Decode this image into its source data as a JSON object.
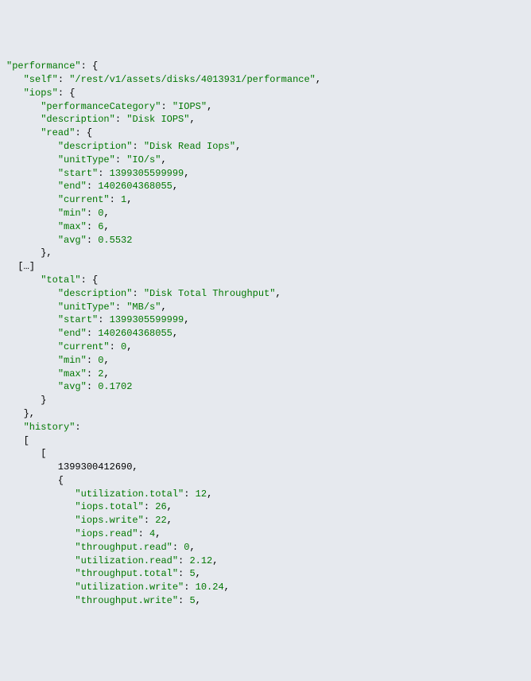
{
  "lines": [
    {
      "indent": 0,
      "key": "\"performance\"",
      "colon": ": {"
    },
    {
      "indent": 3,
      "key": "\"self\"",
      "colon": ": ",
      "value": "\"/rest/v1/assets/disks/4013931/performance\"",
      "suffix": ","
    },
    {
      "indent": 3,
      "key": "\"iops\"",
      "colon": ": {"
    },
    {
      "indent": 6,
      "key": "\"performanceCategory\"",
      "colon": ": ",
      "value": "\"IOPS\"",
      "suffix": ","
    },
    {
      "indent": 6,
      "key": "\"description\"",
      "colon": ": ",
      "value": "\"Disk IOPS\"",
      "suffix": ","
    },
    {
      "indent": 6,
      "key": "\"read\"",
      "colon": ": {"
    },
    {
      "indent": 9,
      "key": "\"description\"",
      "colon": ": ",
      "value": "\"Disk Read Iops\"",
      "suffix": ","
    },
    {
      "indent": 9,
      "key": "\"unitType\"",
      "colon": ": ",
      "value": "\"IO/s\"",
      "suffix": ","
    },
    {
      "indent": 9,
      "key": "\"start\"",
      "colon": ": ",
      "value": "1399305599999",
      "suffix": ","
    },
    {
      "indent": 9,
      "key": "\"end\"",
      "colon": ": ",
      "value": "1402604368055",
      "suffix": ","
    },
    {
      "indent": 9,
      "key": "\"current\"",
      "colon": ": ",
      "value": "1",
      "suffix": ","
    },
    {
      "indent": 9,
      "key": "\"min\"",
      "colon": ": ",
      "value": "0",
      "suffix": ","
    },
    {
      "indent": 9,
      "key": "\"max\"",
      "colon": ": ",
      "value": "6",
      "suffix": ","
    },
    {
      "indent": 9,
      "key": "\"avg\"",
      "colon": ": ",
      "value": "0.5532"
    },
    {
      "indent": 6,
      "plain": "},"
    },
    {
      "indent": 2,
      "plain": "[…]"
    },
    {
      "indent": 6,
      "key": "\"total\"",
      "colon": ": {"
    },
    {
      "indent": 9,
      "key": "\"description\"",
      "colon": ": ",
      "value": "\"Disk Total Throughput\"",
      "suffix": ","
    },
    {
      "indent": 9,
      "key": "\"unitType\"",
      "colon": ": ",
      "value": "\"MB/s\"",
      "suffix": ","
    },
    {
      "indent": 9,
      "key": "\"start\"",
      "colon": ": ",
      "value": "1399305599999",
      "suffix": ","
    },
    {
      "indent": 9,
      "key": "\"end\"",
      "colon": ": ",
      "value": "1402604368055",
      "suffix": ","
    },
    {
      "indent": 9,
      "key": "\"current\"",
      "colon": ": ",
      "value": "0",
      "suffix": ","
    },
    {
      "indent": 9,
      "key": "\"min\"",
      "colon": ": ",
      "value": "0",
      "suffix": ","
    },
    {
      "indent": 9,
      "key": "\"max\"",
      "colon": ": ",
      "value": "2",
      "suffix": ","
    },
    {
      "indent": 9,
      "key": "\"avg\"",
      "colon": ": ",
      "value": "0.1702"
    },
    {
      "indent": 6,
      "plain": "}"
    },
    {
      "indent": 3,
      "plain": "},"
    },
    {
      "indent": 3,
      "key": "\"history\"",
      "colon": ":"
    },
    {
      "indent": 3,
      "plain": "["
    },
    {
      "indent": 6,
      "plain": "["
    },
    {
      "indent": 9,
      "plain": "1399300412690,"
    },
    {
      "indent": 9,
      "plain": "{"
    },
    {
      "indent": 12,
      "key": "\"utilization.total\"",
      "colon": ": ",
      "value": "12",
      "suffix": ","
    },
    {
      "indent": 12,
      "key": "\"iops.total\"",
      "colon": ": ",
      "value": "26",
      "suffix": ","
    },
    {
      "indent": 12,
      "key": "\"iops.write\"",
      "colon": ": ",
      "value": "22",
      "suffix": ","
    },
    {
      "indent": 12,
      "key": "\"iops.read\"",
      "colon": ": ",
      "value": "4",
      "suffix": ","
    },
    {
      "indent": 12,
      "key": "\"throughput.read\"",
      "colon": ": ",
      "value": "0",
      "suffix": ","
    },
    {
      "indent": 12,
      "key": "\"utilization.read\"",
      "colon": ": ",
      "value": "2.12",
      "suffix": ","
    },
    {
      "indent": 12,
      "key": "\"throughput.total\"",
      "colon": ": ",
      "value": "5",
      "suffix": ","
    },
    {
      "indent": 12,
      "key": "\"utilization.write\"",
      "colon": ": ",
      "value": "10.24",
      "suffix": ","
    },
    {
      "indent": 12,
      "key": "\"throughput.write\"",
      "colon": ": ",
      "value": "5",
      "suffix": ","
    }
  ]
}
